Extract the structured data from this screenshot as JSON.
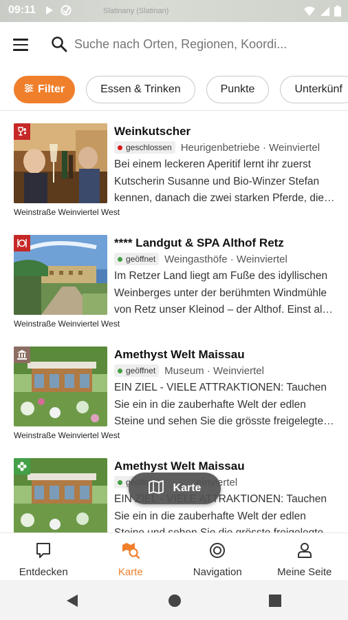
{
  "status_bar": {
    "time": "09:11",
    "map_label": "Slatinany (Slatinan)"
  },
  "search": {
    "placeholder": "Suche nach Orten, Regionen, Koordi..."
  },
  "chips": [
    {
      "label": "Filter"
    },
    {
      "label": "Essen & Trinken"
    },
    {
      "label": "Punkte"
    },
    {
      "label": "Unterkünf"
    }
  ],
  "items": [
    {
      "title": "Weinkutscher",
      "status": "geschlossen",
      "status_color": "#d81b1b",
      "category": "Heurigenbetriebe · Weinviertel",
      "description": "Bei einem leckeren Aperitif lernt ihr zuerst Kutscherin Susanne und Bio-Winzer Stefan kennen, danach die zwei starken Pferde, die…",
      "region": "Weinstraße Weinviertel West",
      "icon": "wine-icon"
    },
    {
      "title": "**** Landgut & SPA Althof Retz",
      "status": "geöffnet",
      "status_color": "#43a047",
      "category": "Weingasthöfe · Weinviertel",
      "description": "Im Retzer Land liegt am Fuße des idyllischen Weinberges unter der berühmten Windmühle von Retz unser Kleinod – der Althof. Einst al…",
      "region": "Weinstraße Weinviertel West",
      "icon": "restaurant-icon"
    },
    {
      "title": "Amethyst Welt Maissau",
      "status": "geöffnet",
      "status_color": "#43a047",
      "category": "Museum · Weinviertel",
      "description": "EIN ZIEL - VIELE ATTRAKTIONEN: Tauchen Sie ein in die zauberhafte Welt der edlen Steine und sehen Sie die grösste freigelegte…",
      "region": "Weinstraße Weinviertel West",
      "icon": "museum-icon"
    },
    {
      "title": "Amethyst Welt Maissau",
      "status": "geöffnet",
      "status_color": "#43a047",
      "category": "einviertel",
      "description": "EIN ZIEL - VIELE ATTRAKTIONEN: Tauchen Sie ein in die zauberhafte Welt der edlen Steine und sehen Sie die grösste freigelegte…",
      "region": "",
      "icon": "flower-icon"
    }
  ],
  "map_button": {
    "label": "Karte"
  },
  "bottom_nav": [
    {
      "label": "Entdecken",
      "icon": "chat-bubble-icon"
    },
    {
      "label": "Karte",
      "icon": "map-search-icon"
    },
    {
      "label": "Navigation",
      "icon": "target-icon"
    },
    {
      "label": "Meine Seite",
      "icon": "user-icon"
    }
  ],
  "colors": {
    "accent": "#f07f2c",
    "open": "#43a047",
    "closed": "#d81b1b"
  }
}
